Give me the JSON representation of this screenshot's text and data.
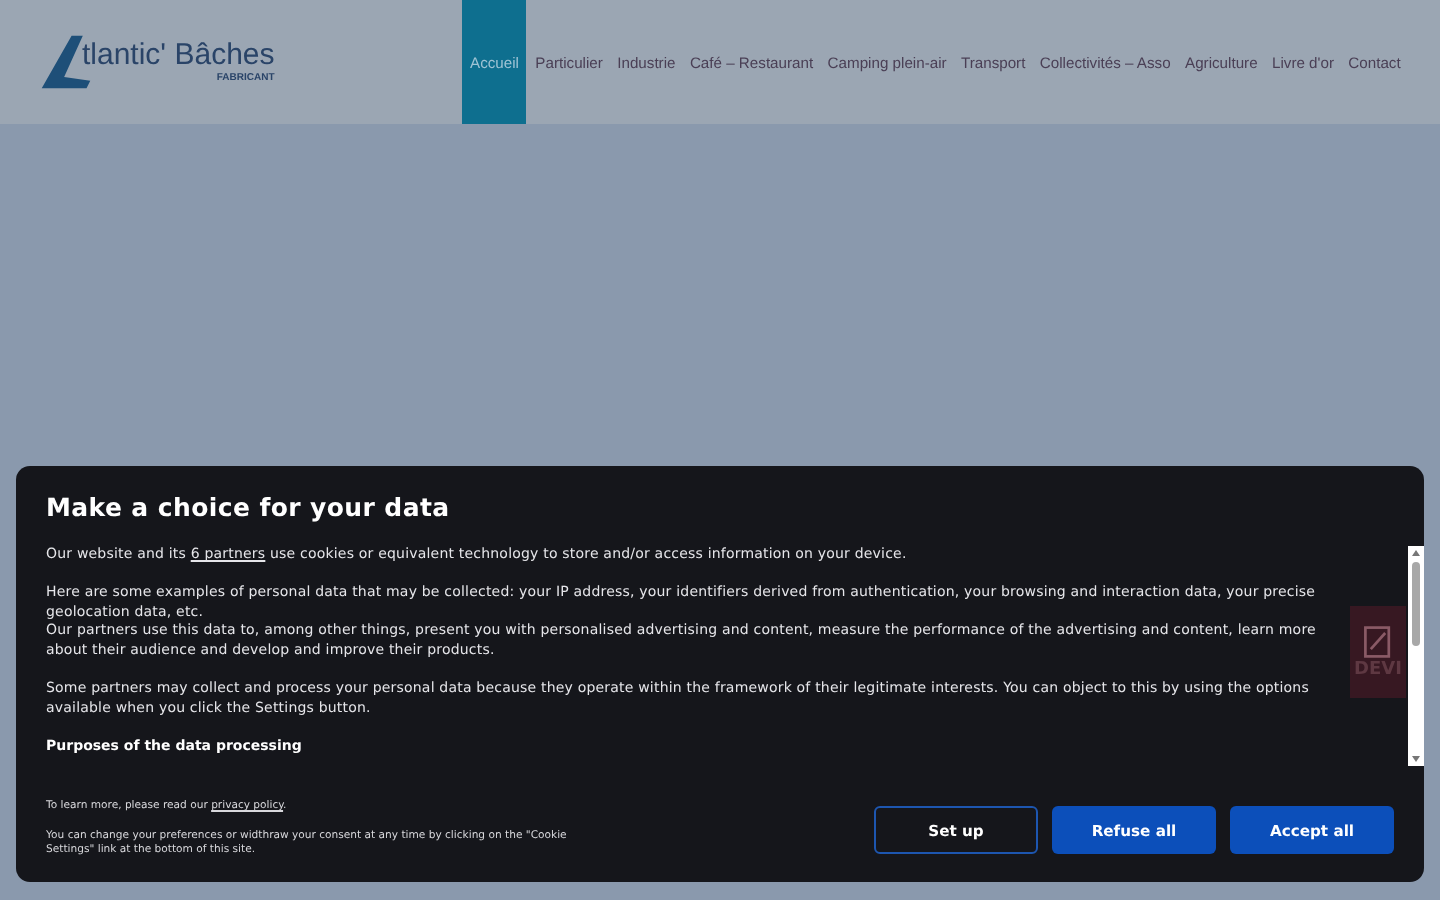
{
  "header": {
    "logo": {
      "name": "tlantic' Bâches",
      "tagline": "FABRICANT"
    },
    "nav": [
      {
        "label": "Accueil",
        "selected": true
      },
      {
        "label": "Particulier",
        "selected": false
      },
      {
        "label": "Industrie",
        "selected": false
      },
      {
        "label": "Café – Restaurant",
        "selected": false
      },
      {
        "label": "Camping plein-air",
        "selected": false
      },
      {
        "label": "Transport",
        "selected": false
      },
      {
        "label": "Collectivités – Asso",
        "selected": false
      },
      {
        "label": "Agriculture",
        "selected": false
      },
      {
        "label": "Livre d'or",
        "selected": false
      },
      {
        "label": "Contact",
        "selected": false
      }
    ]
  },
  "side_badge": {
    "label": "DEVI"
  },
  "consent": {
    "title": "Make a choice for your data",
    "intro": {
      "before": "Our website and its ",
      "link": "6 partners",
      "after": " use cookies or equivalent technology to store and/or access information on your device."
    },
    "paragraphs": [
      "Here are some examples of personal data that may be collected: your IP address, your identifiers derived from authentication, your browsing and interaction data, your precise geolocation data, etc.\nOur partners use this data to, among other things, present you with personalised advertising and content, measure the performance of the advertising and content, learn more about their audience and develop and improve their products.",
      "Some partners may collect and process your personal data because they operate within the framework of their legitimate interests. You can object to this by using the options available when you click the Settings button."
    ],
    "section_heading": "Purposes of the data processing",
    "privacy_note": {
      "before": "To learn more, please read our ",
      "link": "privacy policy",
      "after": "."
    },
    "footer_lines": [
      "You can change your preferences or widthraw your consent at any time by clicking on the \"Cookie Settings\" link at the bottom of this site."
    ],
    "buttons": [
      {
        "label": "Set up",
        "kind": "outline"
      },
      {
        "label": "Refuse all",
        "kind": "filled"
      },
      {
        "label": "Accept all",
        "kind": "filled"
      }
    ]
  }
}
